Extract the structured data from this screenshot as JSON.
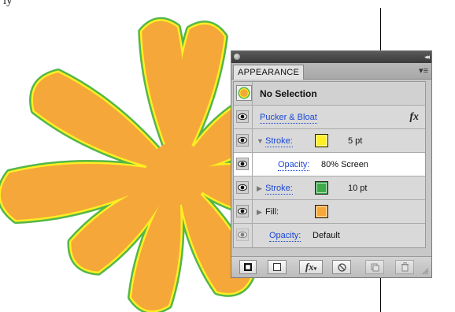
{
  "caption_text": "ly",
  "colors": {
    "flower_fill": "#f5a73a",
    "outer_stroke": "#55b64a",
    "inner_stroke": "#ffee22",
    "stroke_yellow_swatch": "#ffee22",
    "stroke_green_swatch": "#3faa4a",
    "fill_swatch": "#f5a73a"
  },
  "panel": {
    "tab_label": "APPEARANCE",
    "collapse_glyph": "◂◂",
    "menu_glyph": "▾≡",
    "header": {
      "title": "No Selection",
      "thumbnail_icon": "flower-thumbnail"
    },
    "rows": [
      {
        "label": "Pucker & Bloat",
        "fx": "fx"
      },
      {
        "label": "Stroke:",
        "swatch": "stroke_yellow_swatch",
        "value": "5 pt",
        "expanded": true
      },
      {
        "label": "Opacity:",
        "value": "80% Screen",
        "selected": true
      },
      {
        "label": "Stroke:",
        "swatch": "stroke_green_swatch",
        "value": "10 pt",
        "expanded": false
      },
      {
        "label": "Fill:",
        "swatch": "fill_swatch",
        "expanded": false
      },
      {
        "label": "Opacity:",
        "value": "Default"
      }
    ],
    "bottom_buttons": [
      {
        "name": "add-new-stroke-button",
        "icon": "filled-square-icon"
      },
      {
        "name": "add-new-fill-button",
        "icon": "empty-square-icon"
      },
      {
        "name": "add-new-effect-button",
        "icon": "fx-icon",
        "label": "fx"
      },
      {
        "name": "clear-appearance-button",
        "icon": "no-symbol-icon"
      },
      {
        "name": "duplicate-item-button",
        "icon": "duplicate-icon"
      },
      {
        "name": "delete-item-button",
        "icon": "trash-icon"
      }
    ]
  }
}
